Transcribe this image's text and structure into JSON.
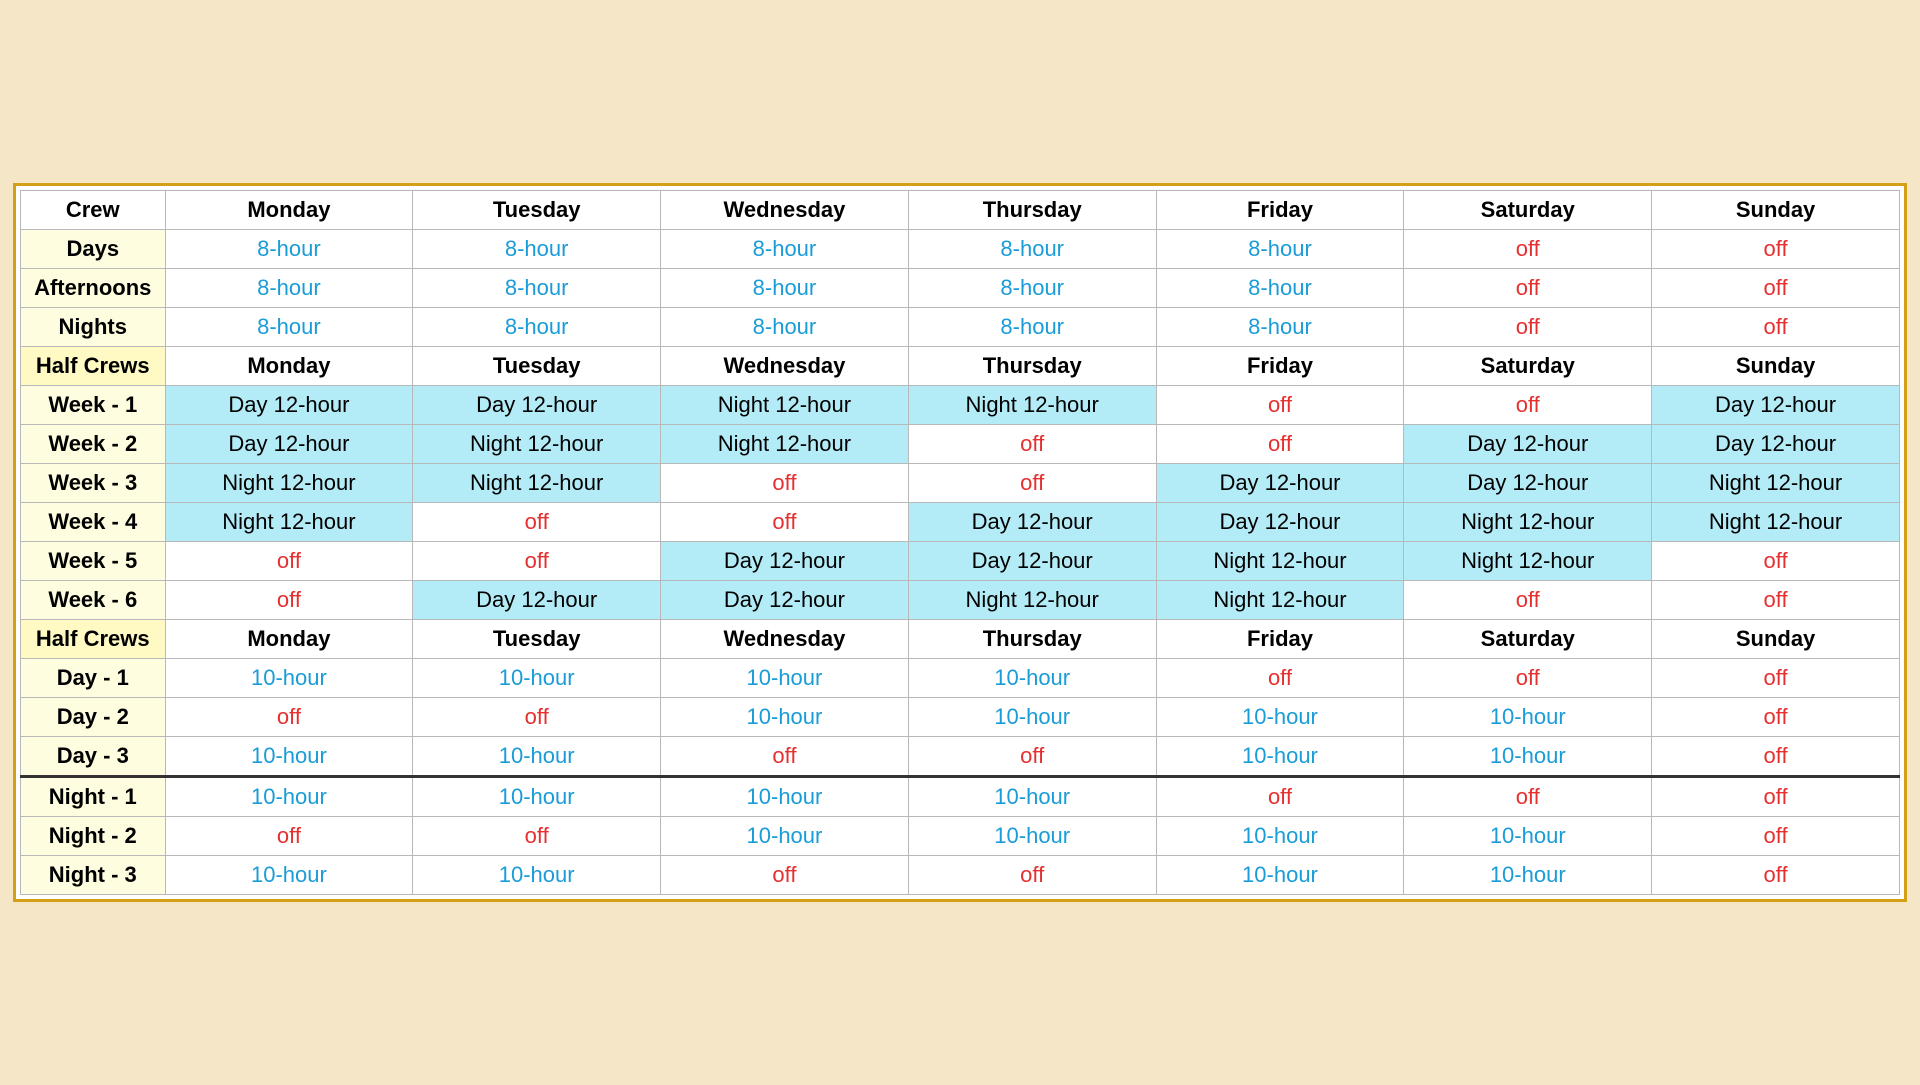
{
  "table": {
    "header1": {
      "crew": "Crew",
      "mon": "Monday",
      "tue": "Tuesday",
      "wed": "Wednesday",
      "thu": "Thursday",
      "fri": "Friday",
      "sat": "Saturday",
      "sun": "Sunday"
    },
    "rows": [
      {
        "id": "days",
        "label": "Days",
        "mon": "8-hour",
        "mon_type": "blue",
        "tue": "8-hour",
        "tue_type": "blue",
        "wed": "8-hour",
        "wed_type": "blue",
        "thu": "8-hour",
        "thu_type": "blue",
        "fri": "8-hour",
        "fri_type": "blue",
        "sat": "off",
        "sat_type": "red",
        "sun": "off",
        "sun_type": "red"
      },
      {
        "id": "afternoons",
        "label": "Afternoons",
        "mon": "8-hour",
        "mon_type": "blue",
        "tue": "8-hour",
        "tue_type": "blue",
        "wed": "8-hour",
        "wed_type": "blue",
        "thu": "8-hour",
        "thu_type": "blue",
        "fri": "8-hour",
        "fri_type": "blue",
        "sat": "off",
        "sat_type": "red",
        "sun": "off",
        "sun_type": "red"
      },
      {
        "id": "nights",
        "label": "Nights",
        "mon": "8-hour",
        "mon_type": "blue",
        "tue": "8-hour",
        "tue_type": "blue",
        "wed": "8-hour",
        "wed_type": "blue",
        "thu": "8-hour",
        "thu_type": "blue",
        "fri": "8-hour",
        "fri_type": "blue",
        "sat": "off",
        "sat_type": "red",
        "sun": "off",
        "sun_type": "red"
      }
    ],
    "header2": {
      "crew": "Half Crews",
      "mon": "Monday",
      "tue": "Tuesday",
      "wed": "Wednesday",
      "thu": "Thursday",
      "fri": "Friday",
      "sat": "Saturday",
      "sun": "Sunday"
    },
    "weeks": [
      {
        "id": "week1",
        "label": "Week - 1",
        "mon": "Day 12-hour",
        "mon_type": "cyan_bg",
        "tue": "Day 12-hour",
        "tue_type": "cyan_bg",
        "wed": "Night 12-hour",
        "wed_type": "cyan_bg",
        "thu": "Night 12-hour",
        "thu_type": "cyan_bg",
        "fri": "off",
        "fri_type": "red",
        "sat": "off",
        "sat_type": "red",
        "sun": "Day 12-hour",
        "sun_type": "cyan_bg"
      },
      {
        "id": "week2",
        "label": "Week - 2",
        "mon": "Day 12-hour",
        "mon_type": "cyan_bg",
        "tue": "Night 12-hour",
        "tue_type": "cyan_bg",
        "wed": "Night 12-hour",
        "wed_type": "cyan_bg",
        "thu": "off",
        "thu_type": "red",
        "fri": "off",
        "fri_type": "red",
        "sat": "Day 12-hour",
        "sat_type": "cyan_bg",
        "sun": "Day 12-hour",
        "sun_type": "cyan_bg"
      },
      {
        "id": "week3",
        "label": "Week - 3",
        "mon": "Night 12-hour",
        "mon_type": "cyan_bg",
        "tue": "Night 12-hour",
        "tue_type": "cyan_bg",
        "wed": "off",
        "wed_type": "red",
        "thu": "off",
        "thu_type": "red",
        "fri": "Day 12-hour",
        "fri_type": "cyan_bg",
        "sat": "Day 12-hour",
        "sat_type": "cyan_bg",
        "sun": "Night 12-hour",
        "sun_type": "cyan_bg"
      },
      {
        "id": "week4",
        "label": "Week - 4",
        "mon": "Night 12-hour",
        "mon_type": "cyan_bg",
        "tue": "off",
        "tue_type": "red",
        "wed": "off",
        "wed_type": "red",
        "thu": "Day 12-hour",
        "thu_type": "cyan_bg",
        "fri": "Day 12-hour",
        "fri_type": "cyan_bg",
        "sat": "Night 12-hour",
        "sat_type": "cyan_bg",
        "sun": "Night 12-hour",
        "sun_type": "cyan_bg"
      },
      {
        "id": "week5",
        "label": "Week - 5",
        "mon": "off",
        "mon_type": "red",
        "tue": "off",
        "tue_type": "red",
        "wed": "Day 12-hour",
        "wed_type": "cyan_bg",
        "thu": "Day 12-hour",
        "thu_type": "cyan_bg",
        "fri": "Night 12-hour",
        "fri_type": "cyan_bg",
        "sat": "Night 12-hour",
        "sat_type": "cyan_bg",
        "sun": "off",
        "sun_type": "red"
      },
      {
        "id": "week6",
        "label": "Week - 6",
        "mon": "off",
        "mon_type": "red",
        "tue": "Day 12-hour",
        "tue_type": "cyan_bg",
        "wed": "Day 12-hour",
        "wed_type": "cyan_bg",
        "thu": "Night 12-hour",
        "thu_type": "cyan_bg",
        "fri": "Night 12-hour",
        "fri_type": "cyan_bg",
        "sat": "off",
        "sat_type": "red",
        "sun": "off",
        "sun_type": "red"
      }
    ],
    "header3": {
      "crew": "Half Crews",
      "mon": "Monday",
      "tue": "Tuesday",
      "wed": "Wednesday",
      "thu": "Thursday",
      "fri": "Friday",
      "sat": "Saturday",
      "sun": "Sunday"
    },
    "days10": [
      {
        "id": "day1",
        "label": "Day - 1",
        "mon": "10-hour",
        "mon_type": "blue",
        "tue": "10-hour",
        "tue_type": "blue",
        "wed": "10-hour",
        "wed_type": "blue",
        "thu": "10-hour",
        "thu_type": "blue",
        "fri": "off",
        "fri_type": "red",
        "sat": "off",
        "sat_type": "red",
        "sun": "off",
        "sun_type": "red"
      },
      {
        "id": "day2",
        "label": "Day - 2",
        "mon": "off",
        "mon_type": "red",
        "tue": "off",
        "tue_type": "red",
        "wed": "10-hour",
        "wed_type": "blue",
        "thu": "10-hour",
        "thu_type": "blue",
        "fri": "10-hour",
        "fri_type": "blue",
        "sat": "10-hour",
        "sat_type": "blue",
        "sun": "off",
        "sun_type": "red"
      },
      {
        "id": "day3",
        "label": "Day - 3",
        "mon": "10-hour",
        "mon_type": "blue",
        "tue": "10-hour",
        "tue_type": "blue",
        "wed": "off",
        "wed_type": "red",
        "thu": "off",
        "thu_type": "red",
        "fri": "10-hour",
        "fri_type": "blue",
        "sat": "10-hour",
        "sat_type": "blue",
        "sun": "off",
        "sun_type": "red"
      }
    ],
    "nights10": [
      {
        "id": "night1",
        "label": "Night - 1",
        "mon": "10-hour",
        "mon_type": "blue",
        "tue": "10-hour",
        "tue_type": "blue",
        "wed": "10-hour",
        "wed_type": "blue",
        "thu": "10-hour",
        "thu_type": "blue",
        "fri": "off",
        "fri_type": "red",
        "sat": "off",
        "sat_type": "red",
        "sun": "off",
        "sun_type": "red"
      },
      {
        "id": "night2",
        "label": "Night - 2",
        "mon": "off",
        "mon_type": "red",
        "tue": "off",
        "tue_type": "red",
        "wed": "10-hour",
        "wed_type": "blue",
        "thu": "10-hour",
        "thu_type": "blue",
        "fri": "10-hour",
        "fri_type": "blue",
        "sat": "10-hour",
        "sat_type": "blue",
        "sun": "off",
        "sun_type": "red"
      },
      {
        "id": "night3",
        "label": "Night - 3",
        "mon": "10-hour",
        "mon_type": "blue",
        "tue": "10-hour",
        "tue_type": "blue",
        "wed": "off",
        "wed_type": "red",
        "thu": "off",
        "thu_type": "red",
        "fri": "10-hour",
        "fri_type": "blue",
        "sat": "10-hour",
        "sat_type": "blue",
        "sun": "off",
        "sun_type": "red"
      }
    ]
  }
}
